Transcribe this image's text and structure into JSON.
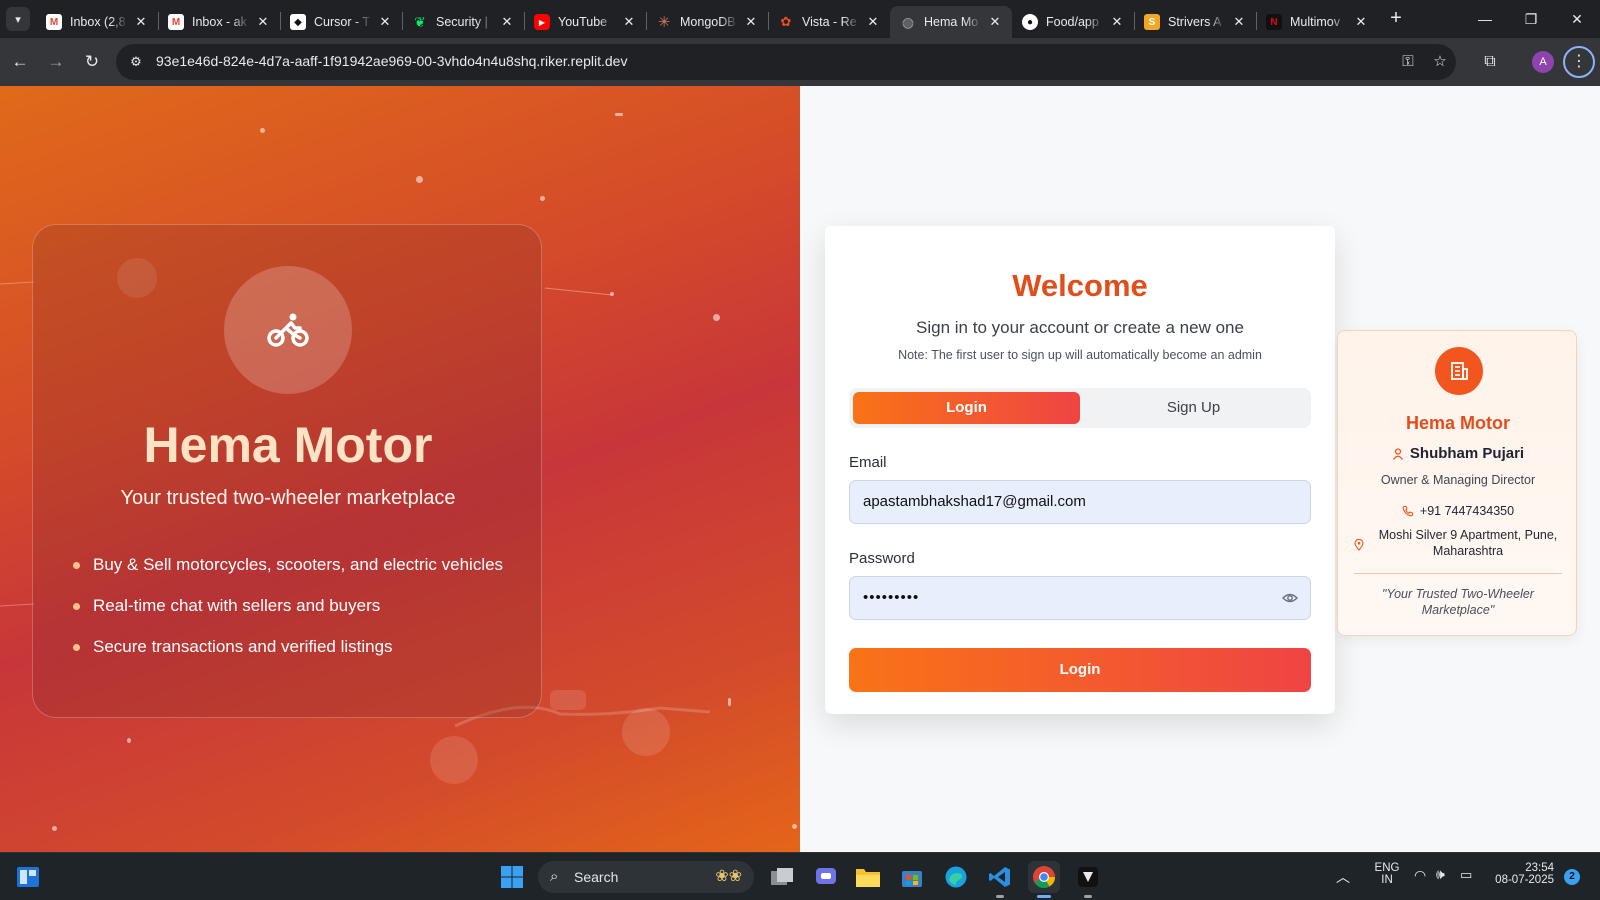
{
  "browser": {
    "tabs": [
      {
        "title": "Inbox (2,8",
        "icon": "gmail-icon",
        "color": "#ea4335"
      },
      {
        "title": "Inbox - ak",
        "icon": "gmail-icon",
        "color": "#ea4335"
      },
      {
        "title": "Cursor - T",
        "icon": "cursor-icon",
        "color": "#ffffff"
      },
      {
        "title": "Security |",
        "icon": "mongodb-leaf-icon",
        "color": "#00ed64"
      },
      {
        "title": "YouTube",
        "icon": "youtube-icon",
        "color": "#ff0000"
      },
      {
        "title": "MongoDB",
        "icon": "claude-icon",
        "color": "#d97757"
      },
      {
        "title": "Vista - Re",
        "icon": "figma-icon",
        "color": "#f24e1e"
      },
      {
        "title": "Hema Mo",
        "icon": "globe-icon",
        "color": "#9aa0a6",
        "active": true
      },
      {
        "title": "Food/app",
        "icon": "github-icon",
        "color": "#ffffff"
      },
      {
        "title": "Strivers A",
        "icon": "striver-icon",
        "color": "#f5a623"
      },
      {
        "title": "Multimov",
        "icon": "netflix-icon",
        "color": "#e50914"
      }
    ],
    "url": "93e1e46d-824e-4d7a-aaff-1f91942ae969-00-3vhdo4n4u8shq.riker.replit.dev"
  },
  "hero": {
    "brand": "Hema Motor",
    "tagline": "Your trusted two-wheeler marketplace",
    "features": [
      "Buy & Sell motorcycles, scooters, and electric vehicles",
      "Real-time chat with sellers and buyers",
      "Secure transactions and verified listings"
    ]
  },
  "login": {
    "title": "Welcome",
    "subtitle": "Sign in to your account or create a new one",
    "note": "Note: The first user to sign up will automatically become an admin",
    "tab_login": "Login",
    "tab_signup": "Sign Up",
    "email_label": "Email",
    "email_value": "apastambhakshad17@gmail.com",
    "password_label": "Password",
    "password_value": "•••••••••",
    "submit": "Login"
  },
  "owner": {
    "brand": "Hema Motor",
    "name": "Shubham Pujari",
    "role": "Owner & Managing Director",
    "phone": "+91 7447434350",
    "address": "Moshi Silver 9 Apartment, Pune, Maharashtra",
    "quote": "\"Your Trusted Two-Wheeler Marketplace\""
  },
  "taskbar": {
    "search": "Search",
    "lang_top": "ENG",
    "lang_bottom": "IN",
    "time": "23:54",
    "date": "08-07-2025",
    "notifications": "2"
  },
  "colors": {
    "accent": "#e24e1b",
    "gradient_start": "#f97316",
    "gradient_end": "#ef4444"
  }
}
